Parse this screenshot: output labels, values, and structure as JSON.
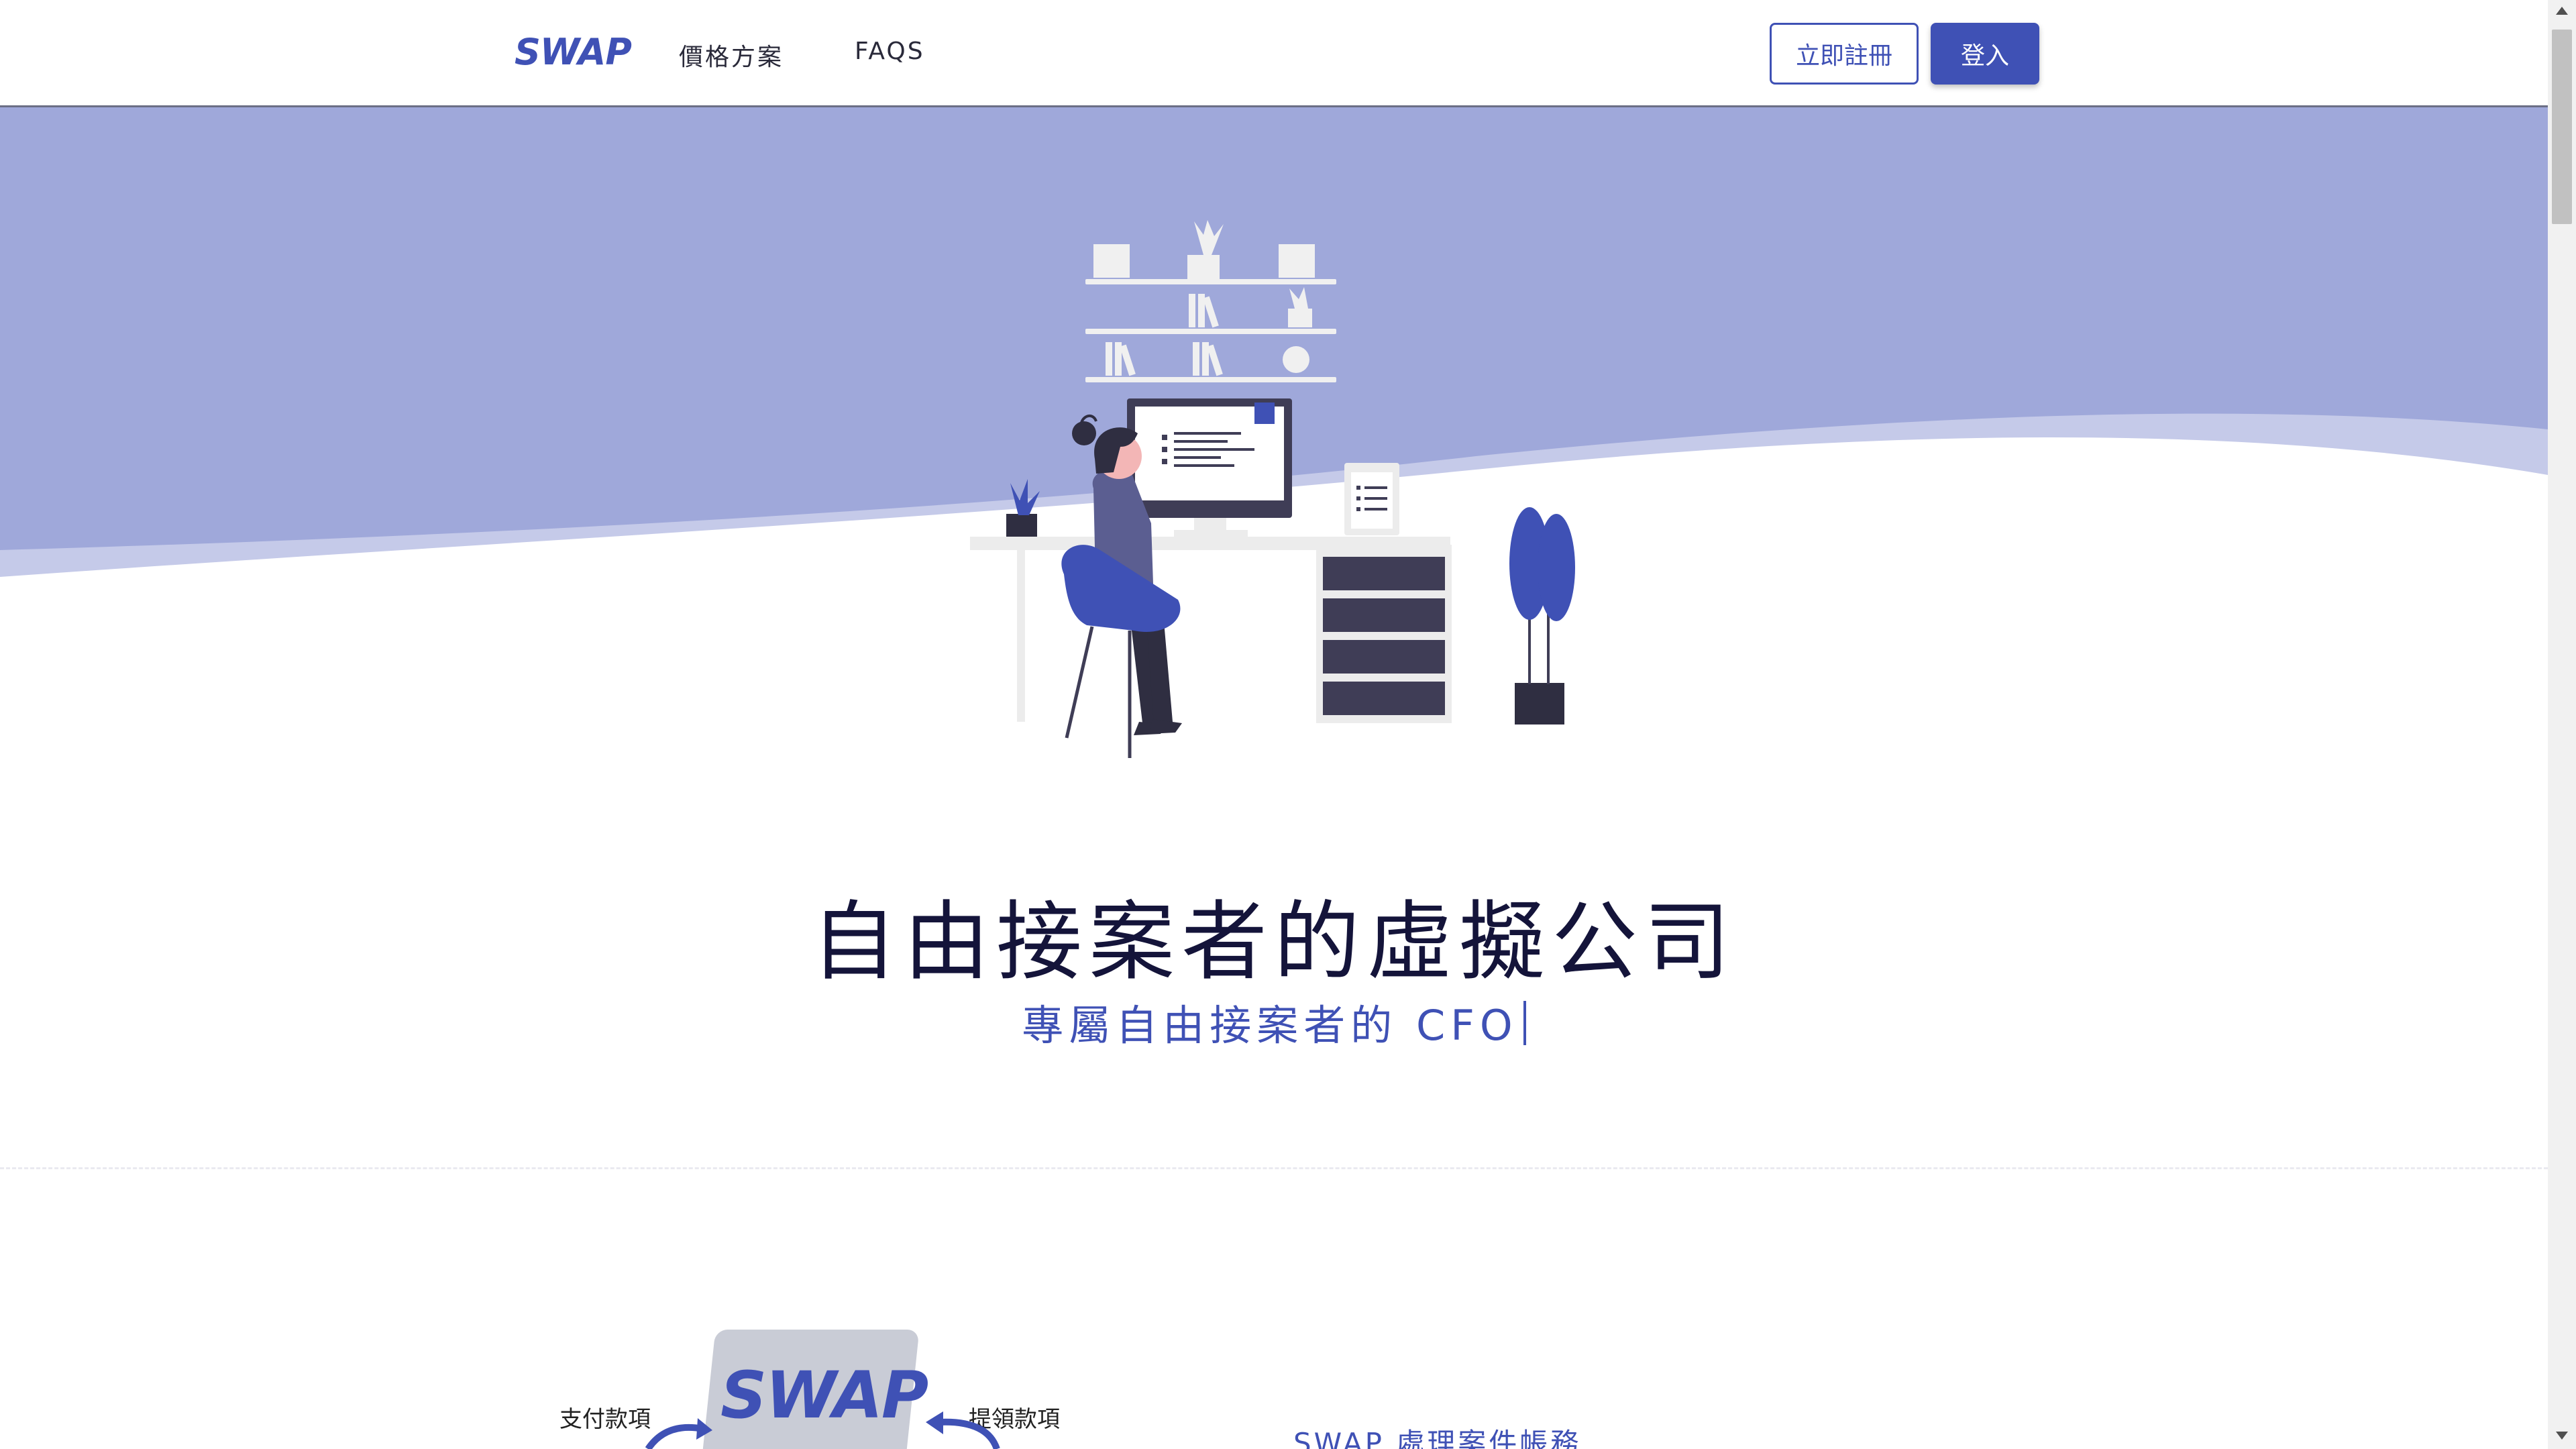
{
  "header": {
    "logo": "SWAP",
    "nav": [
      {
        "label": "價格方案"
      },
      {
        "label": "FAQS"
      }
    ],
    "register_label": "立即註冊",
    "login_label": "登入"
  },
  "hero": {
    "title": "自由接案者的虛擬公司",
    "subtitle": "專屬自由接案者的 CFO"
  },
  "flow": {
    "card_text": "SWAP",
    "left_label": "支付款項",
    "right_label": "提領款項",
    "section_heading": "SWAP 處理案件帳務"
  },
  "colors": {
    "brand": "#3f51b5",
    "hero_wave": "#9fa8da",
    "hero_wave_light": "#c5cae9",
    "title": "#14143a"
  }
}
